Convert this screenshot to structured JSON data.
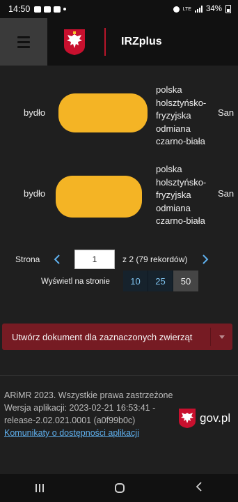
{
  "status_bar": {
    "time": "14:50",
    "network": "LTE",
    "battery": "34%"
  },
  "app_bar": {
    "title": "IRZplus"
  },
  "animals": [
    {
      "species": "bydło",
      "breed": [
        "polska",
        "holsztyńsko-",
        "fryzyjska",
        "odmiana",
        "czarno-biała"
      ],
      "truncated_value": "San"
    },
    {
      "species": "bydło",
      "breed": [
        "polska",
        "holsztyńsko-",
        "fryzyjska",
        "odmiana",
        "czarno-biała"
      ],
      "truncated_value": "San"
    }
  ],
  "pagination": {
    "label": "Strona",
    "current_page": "1",
    "summary": "z 2 (79 rekordów)",
    "per_page_label": "Wyświetl na stronie",
    "per_page_options": [
      "10",
      "25",
      "50"
    ],
    "per_page_selected": "50"
  },
  "action": {
    "label": "Utwórz dokument dla zaznaczonych zwierząt"
  },
  "footer": {
    "copyright": "ARiMR 2023. Wszystkie prawa zastrzeżone",
    "version": "Wersja aplikacji: 2023-02-21 16:53:41 - release-2.02.021.0001 (a0f99b0c)",
    "accessibility_link": "Komunikaty o dostępności aplikacji",
    "gov_label": "gov.pl"
  },
  "colors": {
    "accent_red": "#761b23",
    "separator_red": "#b8152a",
    "link_blue": "#5fb0ee",
    "redaction": "#f4b425"
  }
}
